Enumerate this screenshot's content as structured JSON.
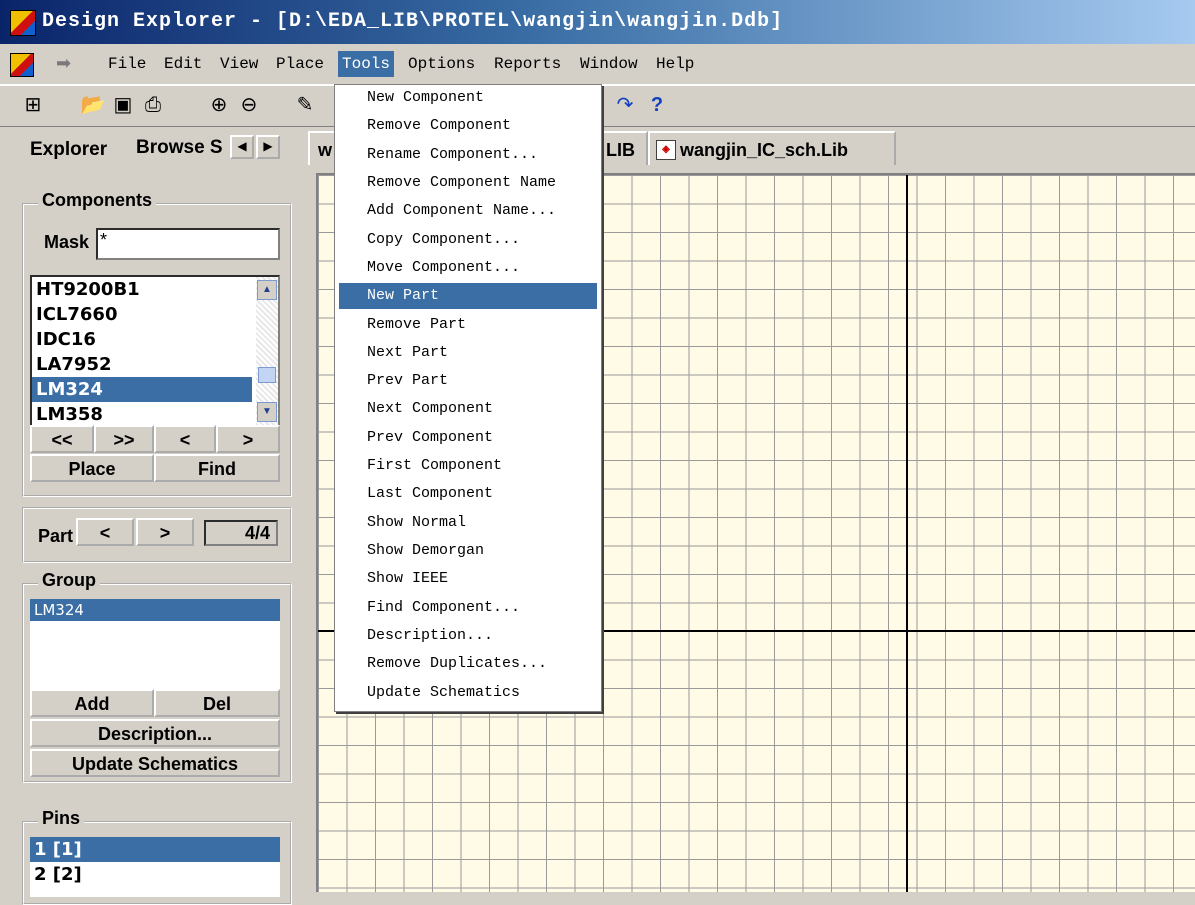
{
  "title": "Design Explorer - [D:\\EDA_LIB\\PROTEL\\wangjin\\wangjin.Ddb]",
  "menu": [
    "File",
    "Edit",
    "View",
    "Place",
    "Tools",
    "Options",
    "Reports",
    "Window",
    "Help"
  ],
  "toolbar": {
    "buttons": [
      "tree-icon",
      "open-icon",
      "save-icon",
      "print-icon",
      "zoom-in-icon",
      "zoom-out-icon",
      "wire-icon",
      "redo-icon",
      "help-icon"
    ],
    "help_label": "?"
  },
  "panel": {
    "tab_explorer": "Explorer",
    "tab_browse": "Browse S",
    "components_title": "Components",
    "mask_label": "Mask",
    "mask_value": "*",
    "component_list": [
      "HT9200B1",
      "ICL7660",
      "IDC16",
      "LA7952",
      "LM324",
      "LM358"
    ],
    "selected_component": "LM324",
    "nav": [
      "<<",
      ">>",
      "<",
      ">"
    ],
    "place": "Place",
    "find": "Find",
    "part_label": "Part",
    "part_prev": "<",
    "part_next": ">",
    "part_value": "4/4",
    "group_title": "Group",
    "group_items": [
      "LM324"
    ],
    "add": "Add",
    "del": "Del",
    "description": "Description...",
    "update": "Update Schematics",
    "pins_title": "Pins",
    "pins": [
      "1  [1]",
      "2  [2]"
    ]
  },
  "doc_tabs": {
    "tab1": "w",
    "tab2": "LIB",
    "tab3": "wangjin_IC_sch.Lib"
  },
  "tools_menu": [
    "New Component",
    "Remove Component",
    "Rename Component...",
    "Remove Component Name",
    "Add Component Name...",
    "Copy Component...",
    "Move Component...",
    "New Part",
    "Remove Part",
    "Next Part",
    "Prev Part",
    "Next Component",
    "Prev Component",
    "First Component",
    "Last Component",
    "Show Normal",
    "Show Demorgan",
    "Show IEEE",
    "Find Component...",
    "Description...",
    "Remove Duplicates...",
    "Update Schematics"
  ],
  "tools_menu_highlighted": "New Part",
  "colors": {
    "selection": "#3a6ea5",
    "sheet": "#fffbe6",
    "chrome": "#d4d0c8"
  }
}
